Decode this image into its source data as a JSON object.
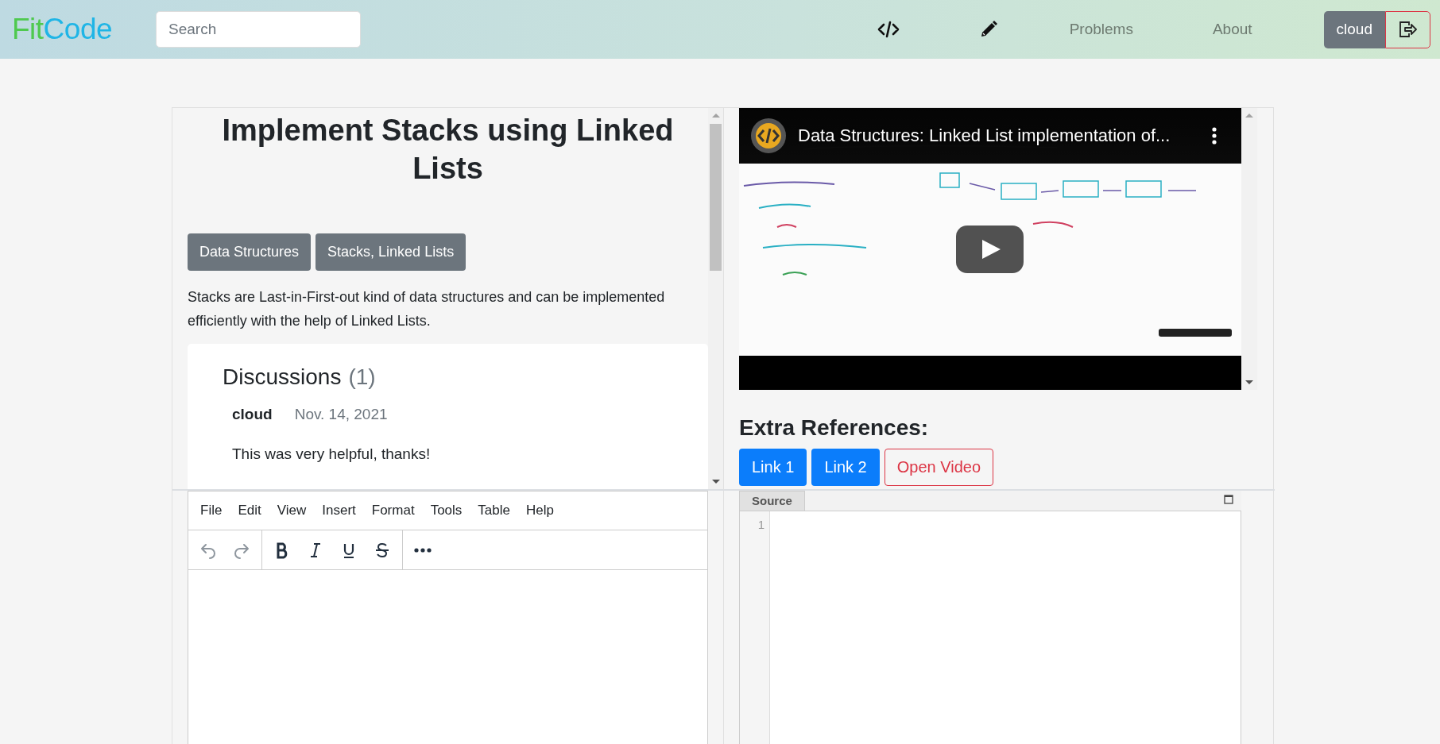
{
  "header": {
    "logo": [
      {
        "text": "Fit",
        "color": "#4fc94f"
      },
      {
        "text": "Code",
        "color": "#1fb5e6"
      }
    ],
    "search": {
      "placeholder": "Search"
    },
    "nav_links": [
      "Problems",
      "About"
    ],
    "user": "cloud"
  },
  "problem": {
    "title": "Implement Stacks using Linked Lists",
    "tags": [
      "Data Structures",
      "Stacks, Linked Lists"
    ],
    "description": "Stacks are Last-in-First-out kind of data structures and can be implemented efficiently with the help of Linked Lists.",
    "discussions": {
      "heading": "Discussions",
      "count": "(1)",
      "comments": [
        {
          "author": "cloud",
          "date": "Nov. 14, 2021",
          "text": "This was very helpful, thanks!"
        }
      ]
    }
  },
  "video": {
    "title": "Data Structures: Linked List implementation of..."
  },
  "references": {
    "heading": "Extra References:",
    "links": [
      {
        "label": "Link 1",
        "kind": "primary"
      },
      {
        "label": "Link 2",
        "kind": "primary"
      },
      {
        "label": "Open Video",
        "kind": "outline"
      }
    ]
  },
  "editor": {
    "menu": [
      "File",
      "Edit",
      "View",
      "Insert",
      "Format",
      "Tools",
      "Table",
      "Help"
    ],
    "toolbar": [
      {
        "kind": "undo",
        "disabled": true
      },
      {
        "kind": "redo",
        "disabled": true
      },
      {
        "kind": "bold",
        "disabled": false
      },
      {
        "kind": "italic",
        "disabled": false
      },
      {
        "kind": "underline",
        "disabled": false
      },
      {
        "kind": "strike",
        "disabled": false
      },
      {
        "kind": "more",
        "disabled": false
      }
    ]
  },
  "source": {
    "tab": "Source",
    "line_numbers": [
      "1"
    ]
  }
}
